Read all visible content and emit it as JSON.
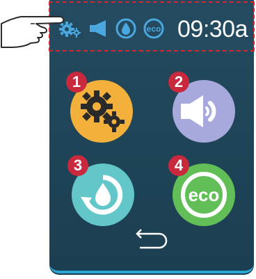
{
  "status": {
    "time": "09:30a",
    "icons": [
      "settings-icon",
      "speaker-icon",
      "water-drop-icon",
      "eco-icon"
    ]
  },
  "menu": {
    "items": [
      {
        "number": "1",
        "icon": "settings-icon",
        "color": "#f3b13c"
      },
      {
        "number": "2",
        "icon": "speaker-icon",
        "color": "#a7a9dc"
      },
      {
        "number": "3",
        "icon": "water-refresh-icon",
        "color": "#63c7c9"
      },
      {
        "number": "4",
        "icon": "eco-icon",
        "color": "#62bf57"
      }
    ],
    "back_icon": "back-arrow-icon",
    "eco_label": "eco"
  },
  "colors": {
    "panel": "#234a5f",
    "accent": "#2aa6d3",
    "badge": "#c8293d",
    "highlight": "#d7262f"
  }
}
